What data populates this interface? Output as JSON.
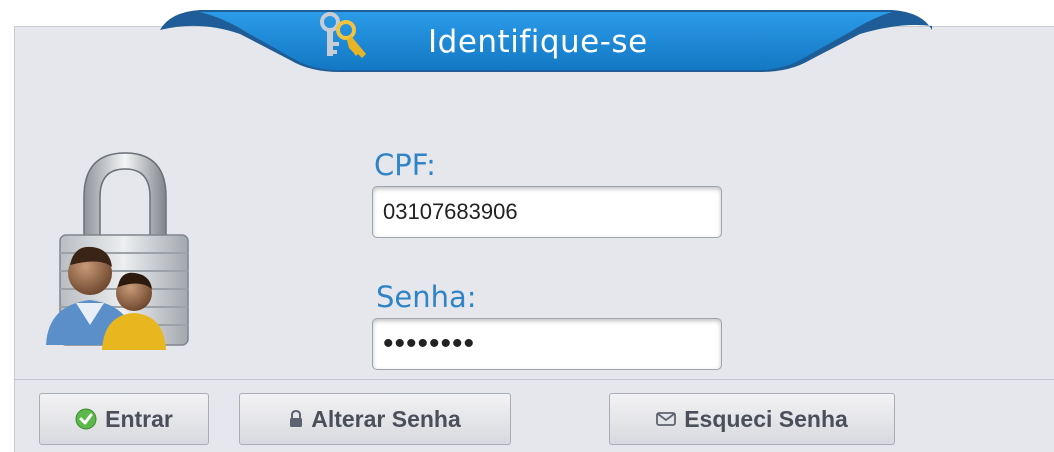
{
  "header": {
    "title": "Identifique-se",
    "icon": "keys-icon",
    "tab_color": "#1b87d5"
  },
  "form": {
    "cpf_label": "CPF:",
    "cpf_value": "03107683906",
    "senha_label": "Senha:",
    "senha_value": "••••••••"
  },
  "illustration": {
    "icon": "lock-users-icon"
  },
  "buttons": {
    "entrar": {
      "label": "Entrar",
      "icon": "check-icon"
    },
    "alterar": {
      "label": "Alterar Senha",
      "icon": "lock-small-icon"
    },
    "esqueci": {
      "label": "Esqueci Senha",
      "icon": "envelope-icon"
    }
  },
  "colors": {
    "accent": "#2e84c6",
    "panel": "#e6e7ec",
    "button_text": "#4a4f5a"
  }
}
